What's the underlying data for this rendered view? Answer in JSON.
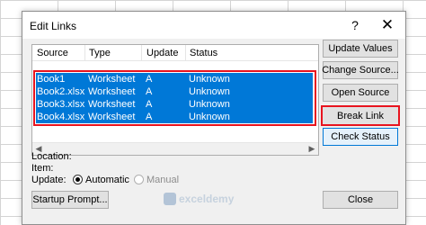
{
  "window": {
    "title": "Edit Links",
    "help_glyph": "?",
    "close_glyph": "✕"
  },
  "table": {
    "headers": [
      "Source",
      "Type",
      "Update",
      "Status"
    ],
    "rows": [
      {
        "source": "Book1",
        "type": "Worksheet",
        "update": "A",
        "status": "Unknown"
      },
      {
        "source": "Book2.xlsx",
        "type": "Worksheet",
        "update": "A",
        "status": "Unknown"
      },
      {
        "source": "Book3.xlsx",
        "type": "Worksheet",
        "update": "A",
        "status": "Unknown"
      },
      {
        "source": "Book4.xlsx",
        "type": "Worksheet",
        "update": "A",
        "status": "Unknown"
      }
    ],
    "scroll_left": "◀",
    "scroll_right": "▶"
  },
  "buttons": {
    "update_values": "Update Values",
    "change_source": "Change Source...",
    "open_source": "Open Source",
    "break_link": "Break Link",
    "check_status": "Check Status",
    "startup_prompt": "Startup Prompt...",
    "close": "Close"
  },
  "details": {
    "location_label": "Location:",
    "item_label": "Item:",
    "update_label": "Update:",
    "automatic_label": "Automatic",
    "manual_label": "Manual",
    "selected_update_mode": "Automatic"
  },
  "watermark": {
    "text": "exceldemy"
  },
  "colors": {
    "selection": "#0078d7",
    "highlight_border": "#e8141f",
    "focus_border": "#0078d7"
  }
}
